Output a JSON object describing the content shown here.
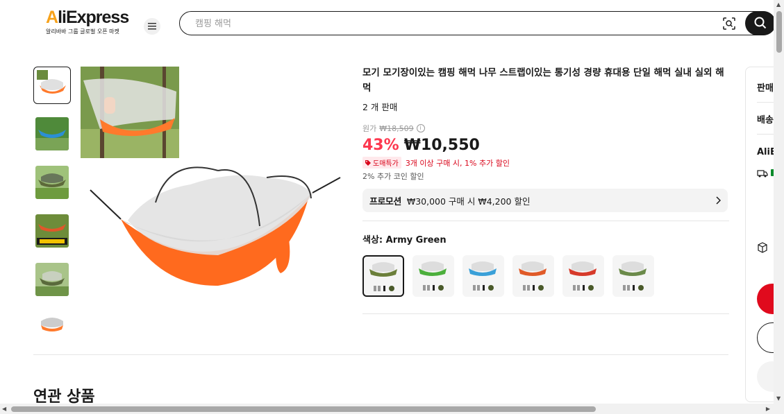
{
  "header": {
    "logo_text_left": "AliExpress",
    "logo_subtitle": "알리바바 그룹 글로벌 오픈 마켓",
    "search_placeholder": "캠핑 해먹"
  },
  "product": {
    "title": "모기 모기장이있는 캠핑 해먹 나무 스트랩이있는 통기성 경량 휴대용 단일 해먹 실내 실외 해먹",
    "sold": "2 개 판매",
    "original_price_label": "원가",
    "original_price": "₩18,509",
    "discount": "43%",
    "price": "₩10,550",
    "wholesale_badge": "도매특가",
    "wholesale_text": "3개 이상 구매 시, 1% 추가 할인",
    "coin_discount": "2% 추가 코인 할인",
    "promo_label": "프로모션",
    "promo_text": "₩30,000 구매 시 ₩4,200 할인",
    "color_label": "색상: Army Green",
    "swatch_colors": [
      "#6b7f3a",
      "#4caf3c",
      "#3aa0d8",
      "#e05a28",
      "#d63a2a",
      "#6b8a4a"
    ]
  },
  "side_panel": {
    "seller_label": "판매",
    "shipping_label": "배송",
    "ali_label": "AliE"
  },
  "related_title": "연관 상품",
  "colors": {
    "accent_red": "#fd384f",
    "logo_orange": "#f7a21b"
  }
}
